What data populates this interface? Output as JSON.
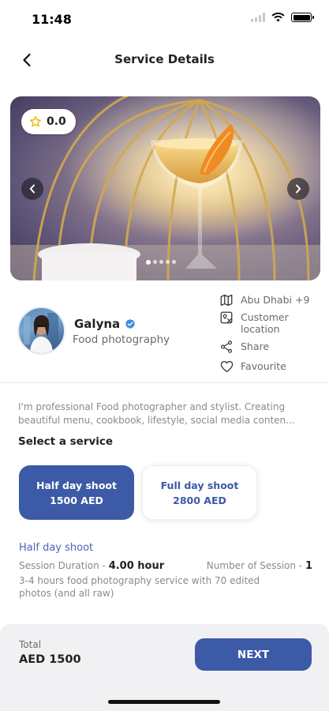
{
  "status_bar": {
    "time": "11:48"
  },
  "header": {
    "title": "Service Details"
  },
  "hero": {
    "rating": "0.0",
    "slide_count": 5,
    "active_slide": 1
  },
  "profile": {
    "name": "Galyna",
    "role": "Food photography"
  },
  "side_actions": [
    {
      "icon": "map-icon",
      "label": "Abu Dhabi +9"
    },
    {
      "icon": "customer-location-icon",
      "label": "Customer location"
    },
    {
      "icon": "share-icon",
      "label": "Share"
    },
    {
      "icon": "heart-icon",
      "label": "Favourite"
    }
  ],
  "description": {
    "line1": "I'm professional Food photographer and stylist. Creating",
    "line2": "beautiful menu, cookbook, lifestyle, social media conten..."
  },
  "services": {
    "title": "Select a service",
    "items": [
      {
        "name": "Half day shoot",
        "price": "1500 AED",
        "selected": true
      },
      {
        "name": "Full day shoot",
        "price": "2800 AED",
        "selected": false
      }
    ]
  },
  "selected_service": {
    "title": "Half day shoot",
    "duration_label": "Session Duration - ",
    "duration_value": "4.00 hour",
    "sessions_label": "Number of Session - ",
    "sessions_value": "1",
    "description": "3-4 hours food photography service with 70 edited photos (and all raw)"
  },
  "footer": {
    "total_label": "Total",
    "total_value": "AED 1500",
    "next_label": "NEXT"
  },
  "colors": {
    "primary": "#3c5aa6",
    "link": "#4a66b3",
    "verified": "#3b8de0",
    "star": "#f2b705"
  }
}
